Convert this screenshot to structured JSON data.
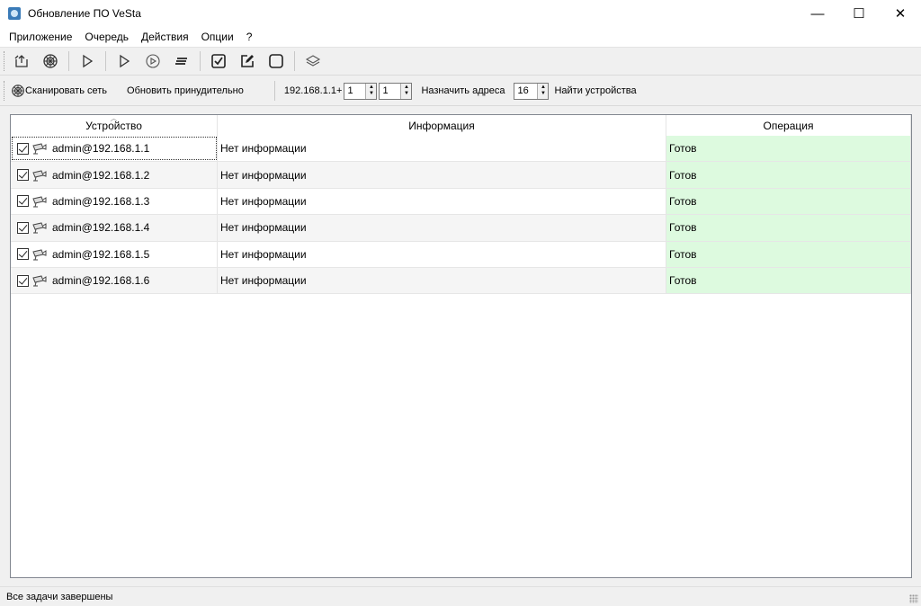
{
  "window": {
    "title": "Обновление ПО VeSta",
    "minimize": "—",
    "maximize": "☐",
    "close": "✕"
  },
  "menu": [
    "Приложение",
    "Очередь",
    "Действия",
    "Опции",
    "?"
  ],
  "toolbar": {
    "icons": [
      "load-icon",
      "scan-icon",
      "play-icon",
      "play-outline-icon",
      "play-circle-icon",
      "list-icon",
      "check-all-icon",
      "edit-icon",
      "uncheck-all-icon",
      "layers-icon"
    ]
  },
  "scanbar": {
    "scan_label": "Сканировать сеть",
    "force_update_label": "Обновить принудительно",
    "ip_prefix": "192.168.1.1+",
    "spin1": "1",
    "spin2": "1",
    "assign_label": "Назначить адреса",
    "count": "16",
    "find_label": "Найти устройства"
  },
  "table": {
    "columns": [
      "Устройство",
      "Информация",
      "Операция"
    ],
    "rows": [
      {
        "device": "admin@192.168.1.1",
        "info": "Нет информации",
        "operation": "Готов"
      },
      {
        "device": "admin@192.168.1.2",
        "info": "Нет информации",
        "operation": "Готов"
      },
      {
        "device": "admin@192.168.1.3",
        "info": "Нет информации",
        "operation": "Готов"
      },
      {
        "device": "admin@192.168.1.4",
        "info": "Нет информации",
        "operation": "Готов"
      },
      {
        "device": "admin@192.168.1.5",
        "info": "Нет информации",
        "operation": "Готов"
      },
      {
        "device": "admin@192.168.1.6",
        "info": "Нет информации",
        "operation": "Готов"
      }
    ]
  },
  "status": {
    "text": "Все задачи завершены"
  },
  "colors": {
    "operation_ready_bg": "#ddfadf",
    "app_icon": "#3a7bb8"
  }
}
